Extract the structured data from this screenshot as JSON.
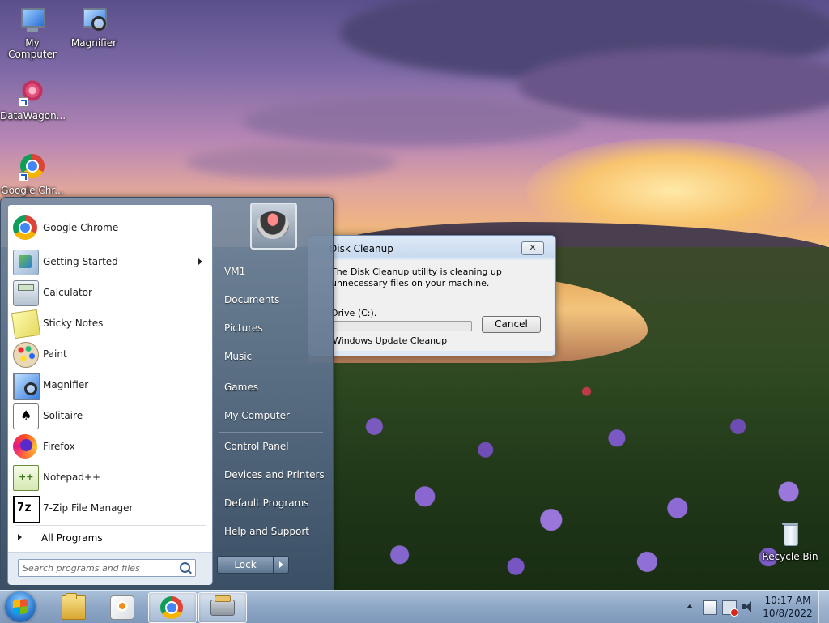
{
  "desktop": {
    "icons": [
      {
        "label": "My Computer",
        "icon": "computer-icon"
      },
      {
        "label": "Magnifier",
        "icon": "magnifier-icon"
      },
      {
        "label": "DataWagon...",
        "icon": "datawagon-icon"
      },
      {
        "label": "Google Chr...",
        "icon": "chrome-icon"
      },
      {
        "label": "Recycle Bin",
        "icon": "recycle-bin-icon"
      }
    ]
  },
  "dialog": {
    "title": "Disk Cleanup",
    "close_label": "✕",
    "message": "The Disk Cleanup utility is cleaning up unnecessary files on your machine.",
    "drive": "Drive  (C:).",
    "progress": 0.0,
    "cancel_label": "Cancel",
    "status": "Windows Update Cleanup"
  },
  "start_menu": {
    "programs": [
      {
        "label": "Google Chrome",
        "icon": "chrome-icon",
        "submenu": false
      },
      {
        "label": "Getting Started",
        "icon": "getting-started-icon",
        "submenu": true
      },
      {
        "label": "Calculator",
        "icon": "calculator-icon",
        "submenu": false
      },
      {
        "label": "Sticky Notes",
        "icon": "sticky-notes-icon",
        "submenu": false
      },
      {
        "label": "Paint",
        "icon": "paint-icon",
        "submenu": false
      },
      {
        "label": "Magnifier",
        "icon": "magnifier-icon",
        "submenu": false
      },
      {
        "label": "Solitaire",
        "icon": "solitaire-icon",
        "submenu": false
      },
      {
        "label": "Firefox",
        "icon": "firefox-icon",
        "submenu": false
      },
      {
        "label": "Notepad++",
        "icon": "notepad-plus-plus-icon",
        "submenu": false
      },
      {
        "label": "7-Zip File Manager",
        "icon": "seven-zip-icon",
        "submenu": false
      }
    ],
    "all_programs_label": "All Programs",
    "search_placeholder": "Search programs and files",
    "right_items": [
      {
        "label": "VM1"
      },
      {
        "label": "Documents"
      },
      {
        "label": "Pictures"
      },
      {
        "label": "Music"
      },
      {
        "label": "Games"
      },
      {
        "label": "My Computer"
      },
      {
        "label": "Control Panel"
      },
      {
        "label": "Devices and Printers"
      },
      {
        "label": "Default Programs"
      },
      {
        "label": "Help and Support"
      }
    ],
    "lock_label": "Lock"
  },
  "taskbar": {
    "pinned": [
      {
        "name": "windows-explorer",
        "icon": "folder-icon"
      },
      {
        "name": "windows-media-player",
        "icon": "media-player-icon"
      },
      {
        "name": "google-chrome",
        "icon": "chrome-icon"
      },
      {
        "name": "disk-cleanup",
        "icon": "disk-cleanup-icon"
      }
    ],
    "clock": {
      "time": "10:17 AM",
      "date": "10/8/2022"
    }
  }
}
